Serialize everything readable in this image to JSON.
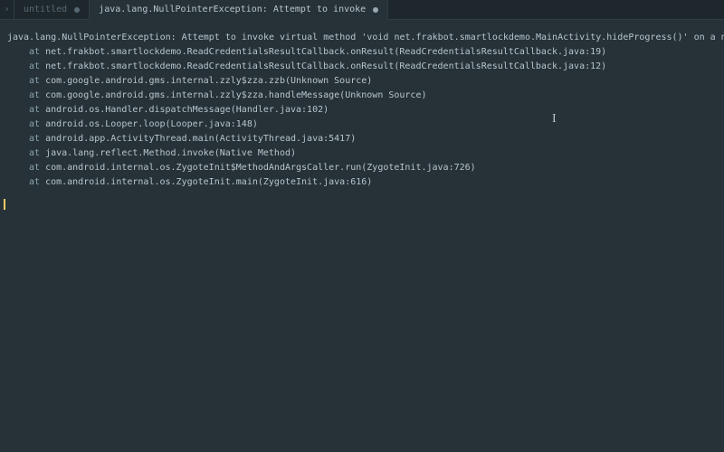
{
  "tabs": {
    "chevron": "›",
    "inactive": {
      "label": "untitled"
    },
    "active": {
      "label": "java.lang.NullPointerException: Attempt to invoke"
    }
  },
  "exception": {
    "header": "java.lang.NullPointerException: Attempt to invoke virtual method 'void net.frakbot.smartlockdemo.MainActivity.hideProgress()' on a null object reference",
    "at_prefix": "at ",
    "frames": [
      "net.frakbot.smartlockdemo.ReadCredentialsResultCallback.onResult(ReadCredentialsResultCallback.java:19)",
      "net.frakbot.smartlockdemo.ReadCredentialsResultCallback.onResult(ReadCredentialsResultCallback.java:12)",
      "com.google.android.gms.internal.zzly$zza.zzb(Unknown Source)",
      "com.google.android.gms.internal.zzly$zza.handleMessage(Unknown Source)",
      "android.os.Handler.dispatchMessage(Handler.java:102)",
      "android.os.Looper.loop(Looper.java:148)",
      "android.app.ActivityThread.main(ActivityThread.java:5417)",
      "java.lang.reflect.Method.invoke(Native Method)",
      "com.android.internal.os.ZygoteInit$MethodAndArgsCaller.run(ZygoteInit.java:726)",
      "com.android.internal.os.ZygoteInit.main(ZygoteInit.java:616)"
    ]
  },
  "icons": {
    "text_cursor": "I"
  }
}
